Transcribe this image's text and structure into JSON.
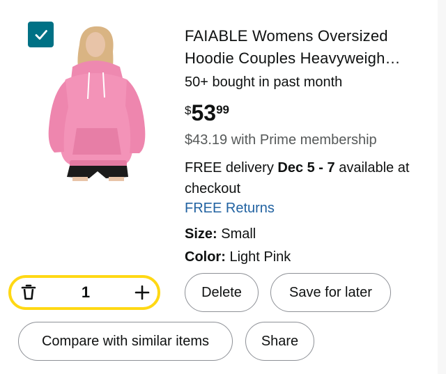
{
  "item": {
    "selected": true,
    "title": "FAIABLE Womens Oversized Hoodie Couples Heavyweigh…",
    "bought": "50+ bought in past month",
    "price": {
      "symbol": "$",
      "whole": "53",
      "fraction": "99"
    },
    "prime_price": "$43.19 with Prime membership",
    "delivery": {
      "prefix": "FREE delivery ",
      "dates": "Dec 5 - 7",
      "suffix": " available at checkout"
    },
    "returns": "FREE Returns",
    "size": {
      "label": "Size:",
      "value": " Small"
    },
    "color": {
      "label": "Color:",
      "value": " Light Pink"
    }
  },
  "quantity": {
    "value": "1"
  },
  "actions": {
    "delete": "Delete",
    "save_for_later": "Save for later",
    "compare": "Compare with similar items",
    "share": "Share"
  },
  "icons": {
    "checkbox": "check-icon",
    "trash": "trash-icon",
    "plus": "plus-icon"
  },
  "colors": {
    "checkbox": "#007185",
    "link": "#2162a1",
    "qty_border": "#ffd814",
    "hoodie": "#f08fb3"
  }
}
